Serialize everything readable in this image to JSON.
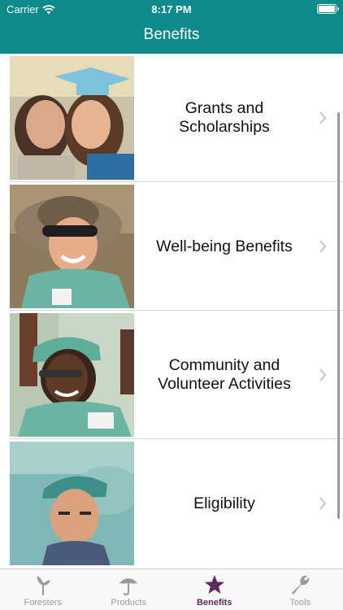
{
  "status_bar": {
    "carrier": "Carrier",
    "time": "8:17 PM"
  },
  "nav": {
    "title": "Benefits"
  },
  "rows": [
    {
      "label": "Grants and Scholarships"
    },
    {
      "label": "Well-being Benefits"
    },
    {
      "label": "Community and Volunteer Activities"
    },
    {
      "label": "Eligibility"
    }
  ],
  "tabs": [
    {
      "label": "Foresters",
      "icon": "sprout-icon"
    },
    {
      "label": "Products",
      "icon": "umbrella-icon"
    },
    {
      "label": "Benefits",
      "icon": "star-icon"
    },
    {
      "label": "Tools",
      "icon": "wrench-icon"
    }
  ],
  "colors": {
    "brand_teal": "#0f8a8b",
    "active_tab": "#5c2a5b",
    "inactive_tab": "#9a9a9a"
  }
}
